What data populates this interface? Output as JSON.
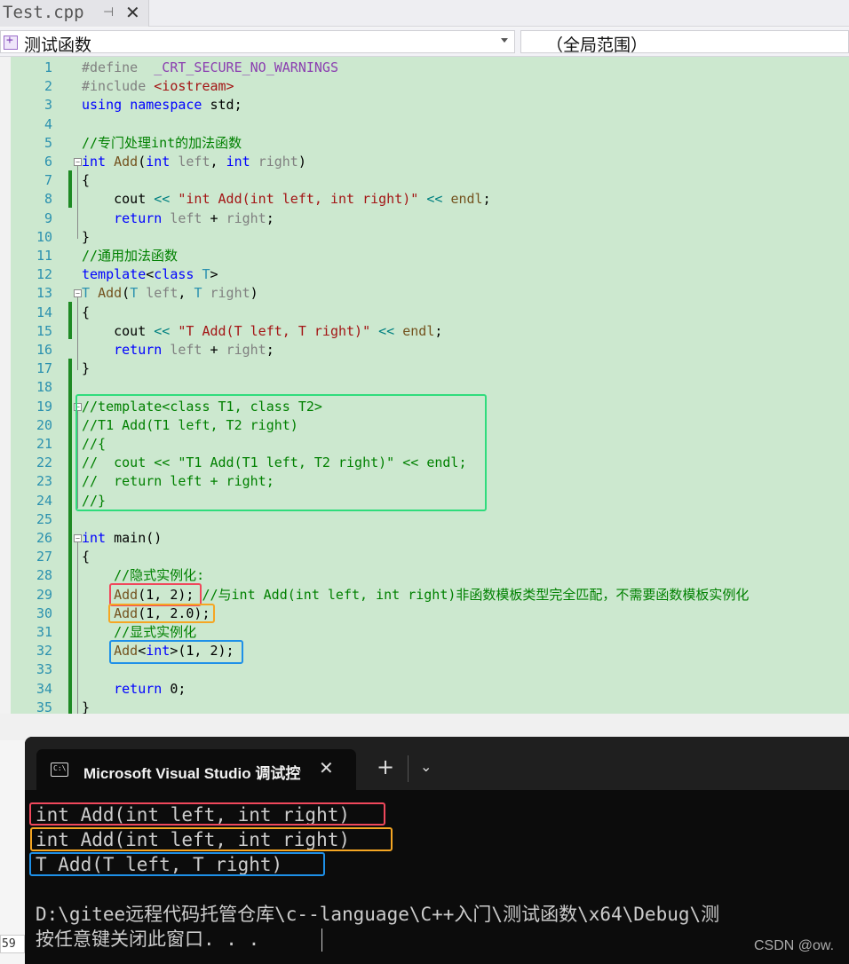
{
  "tab": {
    "title": "Test.cpp"
  },
  "navbar": {
    "scope": "测试函数",
    "global": "（全局范围）"
  },
  "colors": {
    "editor_bg": "#cce8cf",
    "box_green": "#2fdc7c",
    "box_red": "#f0485c",
    "box_orange": "#f5a623",
    "box_blue": "#1e90e8"
  },
  "code_lines": [
    "#define  _CRT_SECURE_NO_WARNINGS",
    "#include <iostream>",
    "using namespace std;",
    "",
    "//专门处理int的加法函数",
    "int Add(int left, int right)",
    "{",
    "    cout << \"int Add(int left, int right)\" << endl;",
    "    return left + right;",
    "}",
    "//通用加法函数",
    "template<class T>",
    "T Add(T left, T right)",
    "{",
    "    cout << \"T Add(T left, T right)\" << endl;",
    "    return left + right;",
    "}",
    "",
    "//template<class T1, class T2>",
    "//T1 Add(T1 left, T2 right)",
    "//{",
    "//  cout << \"T1 Add(T1 left, T2 right)\" << endl;",
    "//  return left + right;",
    "//}",
    "",
    "int main()",
    "{",
    "    //隐式实例化:",
    "    Add(1, 2); //与int Add(int left, int right)非函数模板类型完全匹配，不需要函数模板实例化",
    "    Add(1, 2.0);",
    "    //显式实例化",
    "    Add<int>(1, 2);",
    "",
    "    return 0;",
    "}",
    ""
  ],
  "console": {
    "tab_title": "Microsoft Visual Studio 调试控制台",
    "output": [
      "int Add(int left, int right)",
      "int Add(int left, int right)",
      "T Add(T left, T right)",
      "",
      "D:\\gitee远程代码托管仓库\\c--language\\C++入门\\测试函数\\x64\\Debug\\测",
      "按任意键关闭此窗口. . ."
    ],
    "watermark": "CSDN @ow."
  },
  "statusbar": {
    "zoom_fragment": "59"
  }
}
